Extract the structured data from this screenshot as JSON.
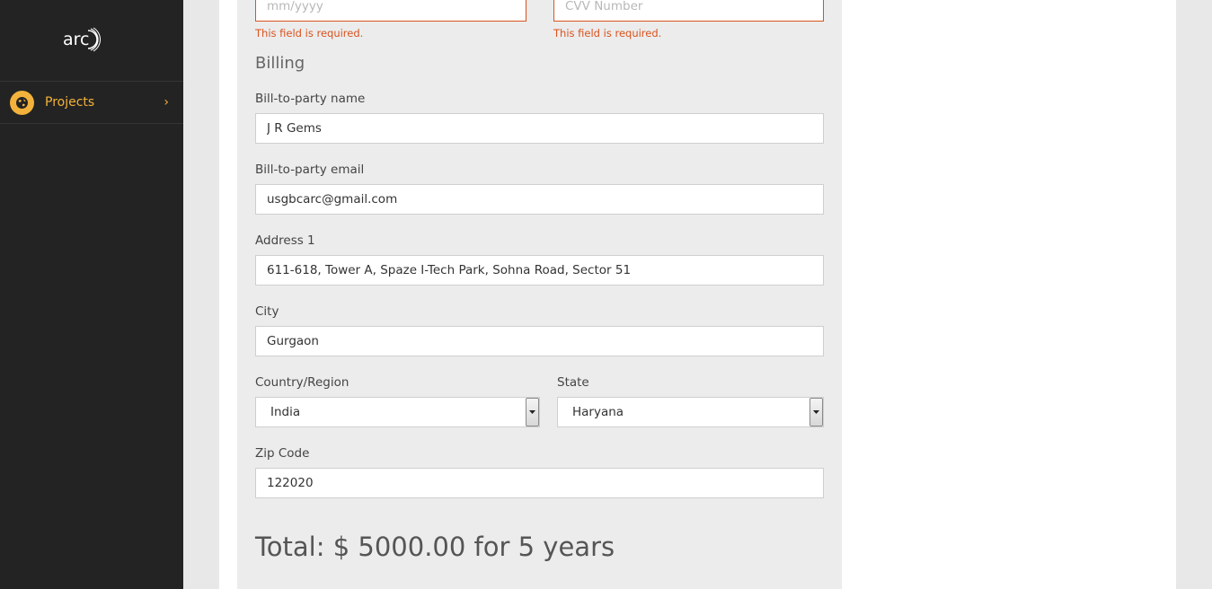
{
  "sidebar": {
    "logo_text": "arc",
    "nav": [
      {
        "label": "Projects",
        "icon": "globe-icon"
      }
    ]
  },
  "payment": {
    "expiry_placeholder": "mm/yyyy",
    "cvv_placeholder": "CVV Number",
    "error_text": "This field is required."
  },
  "billing": {
    "title": "Billing",
    "name_label": "Bill-to-party name",
    "name_value": "J R Gems",
    "email_label": "Bill-to-party email",
    "email_value": "usgbcarc@gmail.com",
    "address_label": "Address 1",
    "address_value": "611-618, Tower A, Spaze I-Tech Park, Sohna Road, Sector 51",
    "city_label": "City",
    "city_value": "Gurgaon",
    "country_label": "Country/Region",
    "country_value": "India",
    "state_label": "State",
    "state_value": "Haryana",
    "zip_label": "Zip Code",
    "zip_value": "122020"
  },
  "total_text": "Total: $ 5000.00 for 5 years",
  "colors": {
    "sidebar_bg": "#232323",
    "accent": "#f3b23b",
    "error": "#d9531e",
    "panel_bg": "#ececec"
  }
}
